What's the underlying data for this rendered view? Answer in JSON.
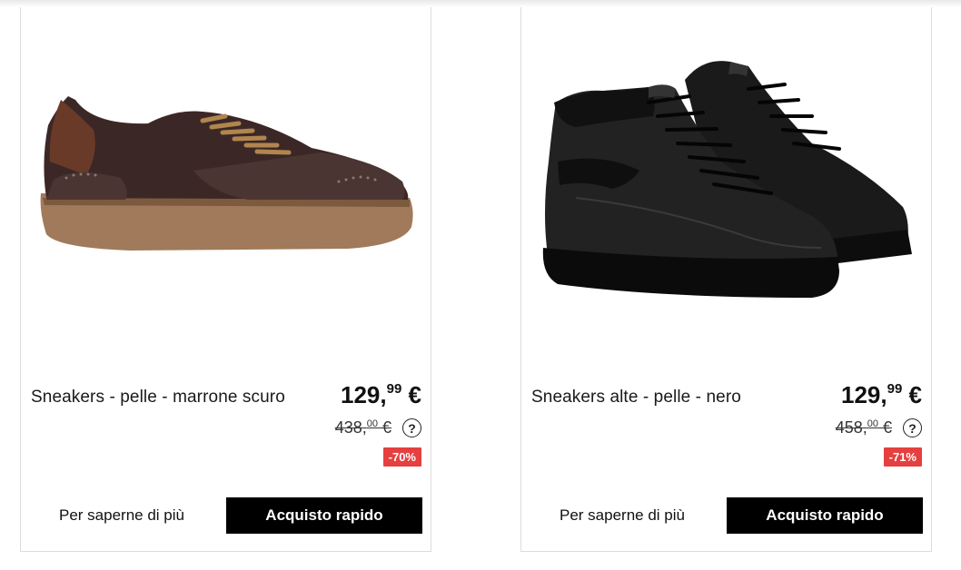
{
  "products": [
    {
      "name": "Sneakers - pelle - marrone scuro",
      "price_int": "129,",
      "price_dec": "99",
      "currency": " €",
      "old_price_int": "438,",
      "old_price_dec": "00",
      "old_currency": " €",
      "help_symbol": "?",
      "discount": "-70%",
      "more_label": "Per saperne di più",
      "buy_label": "Acquisto rapido",
      "image_icon": "brown-low-sneaker-image"
    },
    {
      "name": "Sneakers alte - pelle - nero",
      "price_int": "129,",
      "price_dec": "99",
      "currency": " €",
      "old_price_int": "458,",
      "old_price_dec": "00",
      "old_currency": " €",
      "help_symbol": "?",
      "discount": "-71%",
      "more_label": "Per saperne di più",
      "buy_label": "Acquisto rapido",
      "image_icon": "black-high-top-sneakers-image"
    }
  ],
  "colors": {
    "discount_badge": "#e5403f",
    "button_bg": "#000000",
    "card_border": "#dcdcdc"
  }
}
